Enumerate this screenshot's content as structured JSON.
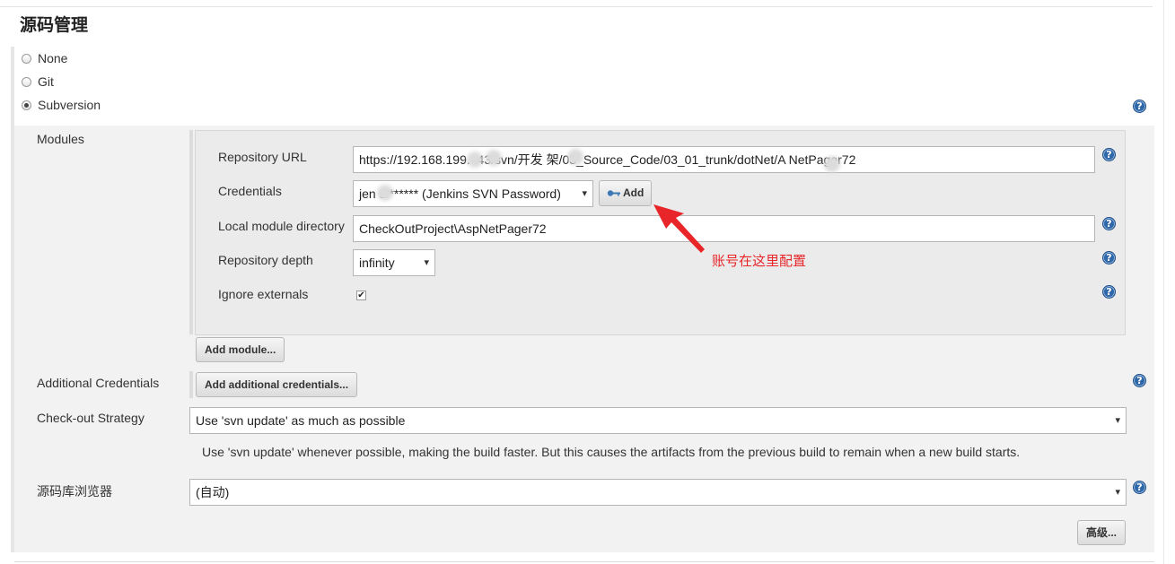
{
  "section": {
    "title": "源码管理"
  },
  "scm_options": [
    {
      "label": "None",
      "selected": false
    },
    {
      "label": "Git",
      "selected": false
    },
    {
      "label": "Subversion",
      "selected": true
    }
  ],
  "modules": {
    "label": "Modules",
    "repository_url": {
      "label": "Repository URL",
      "value": "https://192.168.199.   .43/svn/开发   架/03_Source_Code/03_01_trunk/dotNet/A   NetPager72"
    },
    "credentials": {
      "label": "Credentials",
      "value": "jen   s/****** (Jenkins SVN Password)",
      "add_label": "Add"
    },
    "local_module_directory": {
      "label": "Local module directory",
      "value": "CheckOutProject\\AspNetPager72"
    },
    "repository_depth": {
      "label": "Repository depth",
      "value": "infinity"
    },
    "ignore_externals": {
      "label": "Ignore externals",
      "checked": true,
      "mark": "✔"
    },
    "add_module_label": "Add module..."
  },
  "additional_credentials": {
    "label": "Additional Credentials",
    "button_label": "Add additional credentials..."
  },
  "checkout_strategy": {
    "label": "Check-out Strategy",
    "value": "Use 'svn update' as much as possible",
    "description": "Use 'svn update' whenever possible, making the build faster. But this causes the artifacts from the previous build to remain when a new build starts."
  },
  "repo_browser": {
    "label": "源码库浏览器",
    "value": "(自动)"
  },
  "advanced_label": "高级...",
  "annotation": {
    "text": "账号在这里配置",
    "color": "#e8262a"
  },
  "help_glyph": "?",
  "icons": {
    "help": "help-icon",
    "key": "key-icon",
    "arrow": "annotation-arrow-icon"
  },
  "colors": {
    "help_blue": "#2f68a8",
    "panel_gray": "#f2f2f2",
    "annotation_red": "#e8262a"
  }
}
